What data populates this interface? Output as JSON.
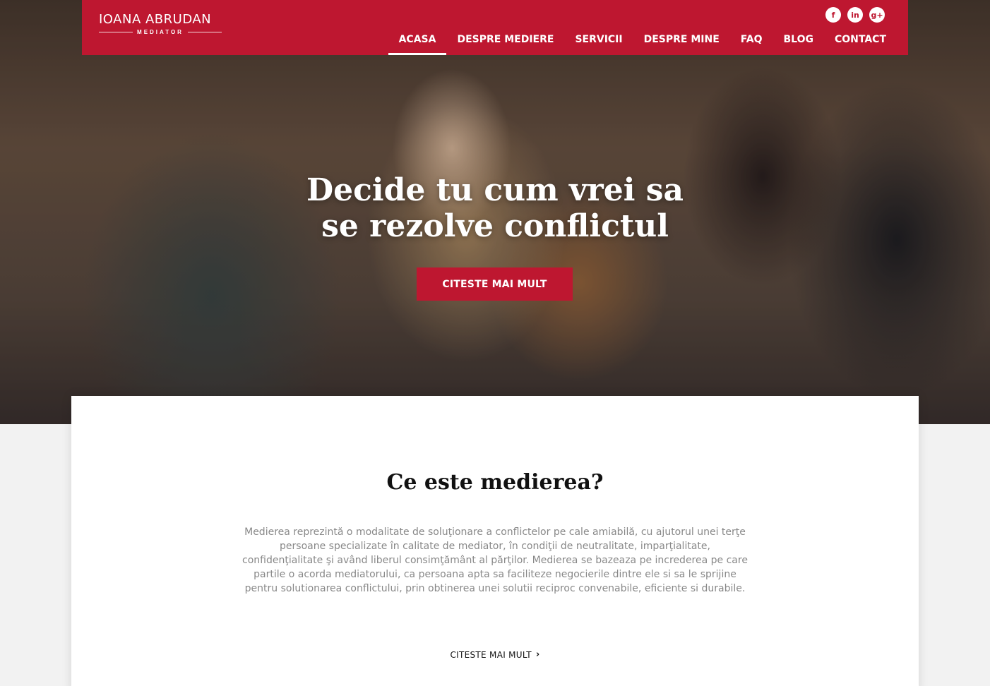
{
  "header": {
    "logo_name": "IOANA ABRUDAN",
    "logo_tagline": "MEDIATOR",
    "social": [
      {
        "icon": "facebook-icon",
        "glyph": "f"
      },
      {
        "icon": "linkedin-icon",
        "glyph": "in"
      },
      {
        "icon": "google-plus-icon",
        "glyph": "g+"
      }
    ],
    "nav": [
      "ACASA",
      "DESPRE MEDIERE",
      "SERVICII",
      "DESPRE MINE",
      "FAQ",
      "BLOG",
      "CONTACT"
    ],
    "active_nav": "ACASA"
  },
  "hero": {
    "title_line1": "Decide tu cum vrei sa",
    "title_line2": "se rezolve conflictul",
    "button_label": "CITESTE MAI MULT"
  },
  "intro": {
    "title": "Ce este medierea?",
    "text": "Medierea reprezintă o modalitate de soluţionare a conflictelor pe cale amiabilă, cu ajutorul unei terţe persoane specializate în calitate de mediator, în condiţii de neutralitate, imparţialitate, confidenţialitate şi având liberul consimţământ al părţilor. Medierea se bazeaza pe increderea pe care partile o acorda mediatorului, ca persoana apta sa faciliteze negocierile dintre ele si sa le sprijine pentru solutionarea conflictului, prin obtinerea unei solutii reciproc convenabile, eficiente si durabile.",
    "link_label": "CITESTE MAI MULT"
  },
  "colors": {
    "brand": "#be1730",
    "text_muted": "#888888"
  }
}
